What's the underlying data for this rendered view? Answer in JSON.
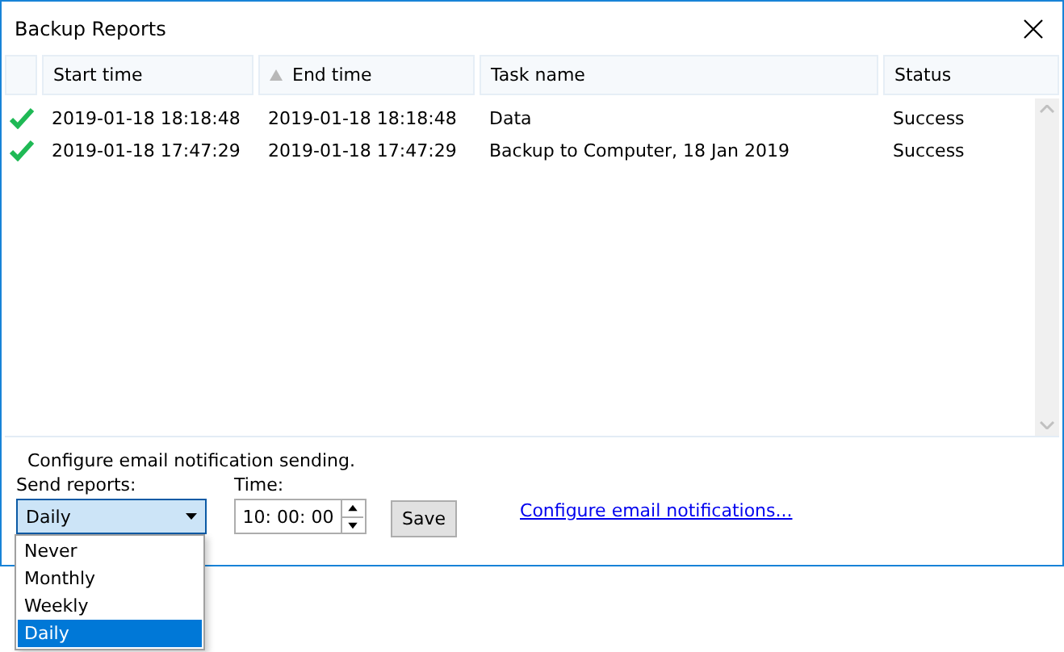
{
  "window": {
    "title": "Backup Reports"
  },
  "table": {
    "columns": [
      {
        "label": "Start time",
        "sorted": false
      },
      {
        "label": "End time",
        "sorted": true
      },
      {
        "label": "Task name",
        "sorted": false
      },
      {
        "label": "Status",
        "sorted": false
      }
    ],
    "rows": [
      {
        "succeeded": true,
        "cells": [
          "2019-01-18 18:18:48",
          "2019-01-18 18:18:48",
          "Data",
          "Success"
        ]
      },
      {
        "succeeded": true,
        "cells": [
          "2019-01-18 17:47:29",
          "2019-01-18 17:47:29",
          "Backup to Computer, 18 Jan 2019",
          "Success"
        ]
      }
    ]
  },
  "settings": {
    "heading": "Configure email notification sending.",
    "send_label": "Send reports:",
    "send_value": "Daily",
    "expanded": true,
    "options": [
      {
        "label": "Never",
        "selected": false
      },
      {
        "label": "Monthly",
        "selected": false
      },
      {
        "label": "Weekly",
        "selected": false
      },
      {
        "label": "Daily",
        "selected": true
      }
    ],
    "time_label": "Time:",
    "time_value": "10: 00: 00",
    "save": "Save",
    "link": "Configure email notifications..."
  }
}
